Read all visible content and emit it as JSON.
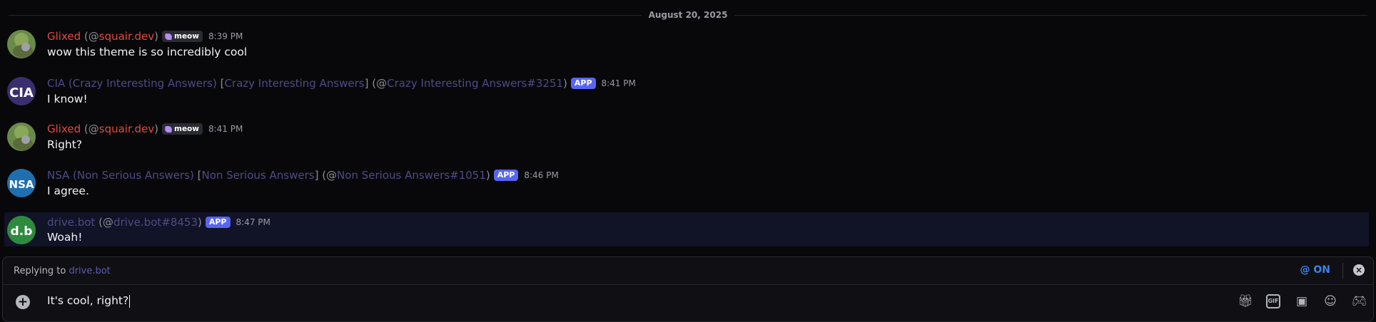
{
  "date_divider": "August 20, 2025",
  "messages": [
    {
      "display_name": "Glixed",
      "handle": "squair.dev",
      "tag": "meow",
      "time": "8:39 PM",
      "text": "wow this theme is so incredibly cool",
      "avatar_color": "#6a8a4a"
    },
    {
      "display_name": "CIA (Crazy Interesting Answers)",
      "bracket_name": "Crazy Interesting Answers",
      "handle": "Crazy Interesting Answers#3251",
      "badge": "APP",
      "time": "8:41 PM",
      "text": "I know!",
      "avatar_text": "CIA",
      "avatar_color": "#3b2e6e"
    },
    {
      "display_name": "Glixed",
      "handle": "squair.dev",
      "tag": "meow",
      "time": "8:41 PM",
      "text": "Right?",
      "avatar_color": "#6a8a4a"
    },
    {
      "display_name": "NSA (Non Serious Answers)",
      "bracket_name": "Non Serious Answers",
      "handle": "Non Serious Answers#1051",
      "badge": "APP",
      "time": "8:46 PM",
      "text": "I agree.",
      "avatar_text": "NSA",
      "avatar_color": "#1f6fb0"
    },
    {
      "display_name": "drive.bot",
      "handle": "drive.bot#8453",
      "badge": "APP",
      "time": "8:47 PM",
      "text": "Woah!",
      "avatar_text": "d.b",
      "avatar_color": "#2e8b3e"
    }
  ],
  "composer": {
    "replying_prefix": "Replying to",
    "replying_to": "drive.bot",
    "mention_toggle": "@ ON",
    "input_value": "It's cool, right?",
    "icons": [
      "gift-icon",
      "gif-icon",
      "sticker-icon",
      "emoji-icon",
      "game-controller-icon"
    ]
  },
  "colors": {
    "username": "#e24a3a",
    "bot_name": "#4d4b86",
    "app_badge": "#5865f2",
    "highlight": "#111327",
    "mention_on": "#3c82e8"
  }
}
